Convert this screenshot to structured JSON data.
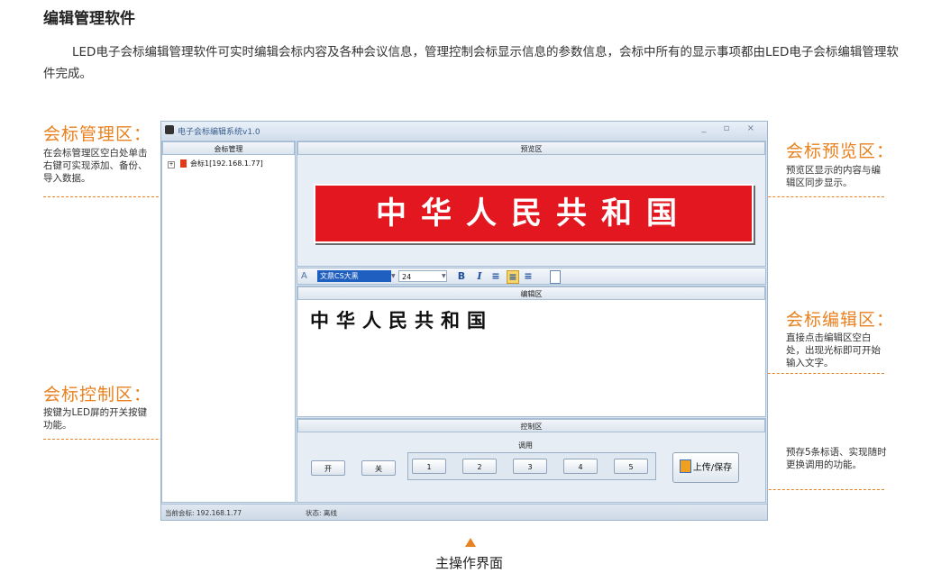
{
  "heading": "编辑管理软件",
  "intro": "LED电子会标编辑管理软件可实时编辑会标内容及各种会议信息，管理控制会标显示信息的参数信息，会标中所有的显示事项都由LED电子会标编辑管理软件完成。",
  "callouts": {
    "manage": {
      "title": "会标管理区：",
      "desc": "在会标管理区空白处单击右键可实现添加、备份、导入数据。"
    },
    "preview": {
      "title": "会标预览区：",
      "desc": "预览区显示的内容与编辑区同步显示。"
    },
    "edit": {
      "title": "会标编辑区：",
      "desc": "直接点击编辑区空白处，出现光标即可开始输入文字。"
    },
    "control": {
      "title": "会标控制区：",
      "desc": "按键为LED屏的开关按键功能。"
    },
    "preset": {
      "desc": "预存5条标语、实现随时更换调用的功能。"
    }
  },
  "window": {
    "title": "电子会标编辑系统v1.0",
    "controls": "_ ▫ ×",
    "tree_header": "会标管理",
    "tree_item": "会标1[192.168.1.77]",
    "preview_header": "预览区",
    "banner_text": "中华人民共和国",
    "toolbar": {
      "font": "文鼎CS大黑",
      "size": "24",
      "bold": "B",
      "italic": "I"
    },
    "editor_header": "编辑区",
    "editor_text": "中华人民共和国",
    "control_header": "控制区",
    "recall_label": "调用",
    "on_label": "开",
    "off_label": "关",
    "presets": [
      "1",
      "2",
      "3",
      "4",
      "5"
    ],
    "save_label": "上传/保存",
    "status_left": "当前会标: 192.168.1.77",
    "status_right": "状态: 离线"
  },
  "caption": "主操作界面",
  "colors": {
    "accent": "#e8811f",
    "banner": "#e2171f"
  }
}
